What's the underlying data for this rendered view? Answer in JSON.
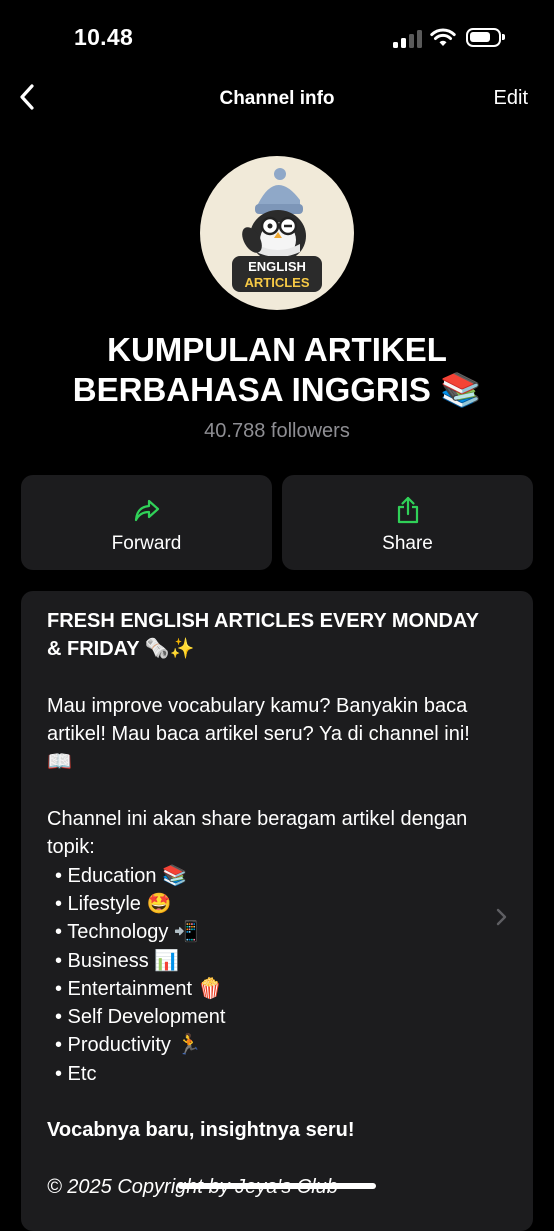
{
  "status_bar": {
    "time": "10.48",
    "signal_icon": "cellular-signal-icon",
    "wifi_icon": "wifi-icon",
    "battery_icon": "battery-icon"
  },
  "nav": {
    "back_icon": "chevron-left-icon",
    "title": "Channel info",
    "edit_label": "Edit"
  },
  "channel": {
    "avatar_logo_text": "ENGLISH ARTICLES",
    "name": "KUMPULAN ARTIKEL BERBAHASA INGGRIS 📚",
    "followers": "40.788 followers"
  },
  "actions": {
    "forward": {
      "label": "Forward",
      "icon": "forward-arrow-icon"
    },
    "share": {
      "label": "Share",
      "icon": "share-icon"
    }
  },
  "description": {
    "headline": "FRESH ENGLISH ARTICLES EVERY MONDAY & FRIDAY 🗞️✨",
    "intro": "Mau improve vocabulary kamu? Banyakin baca artikel! Mau baca artikel seru? Ya di channel ini! 📖",
    "topics_intro": "Channel ini akan share beragam artikel dengan topik:",
    "topics": [
      "• Education 📚",
      "• Lifestyle 🤩",
      "• Technology 📲",
      "• Business 📊",
      "• Entertainment 🍿",
      "• Self Development",
      "• Productivity 🏃",
      "• Etc"
    ],
    "tagline": "Vocabnya baru, insightnya seru!",
    "copyright": "© 2025 Copyright by Jeya's Club"
  },
  "colors": {
    "background": "#000000",
    "card": "#1c1c1e",
    "accent_green": "#30d158",
    "secondary_text": "#8e8e93"
  }
}
